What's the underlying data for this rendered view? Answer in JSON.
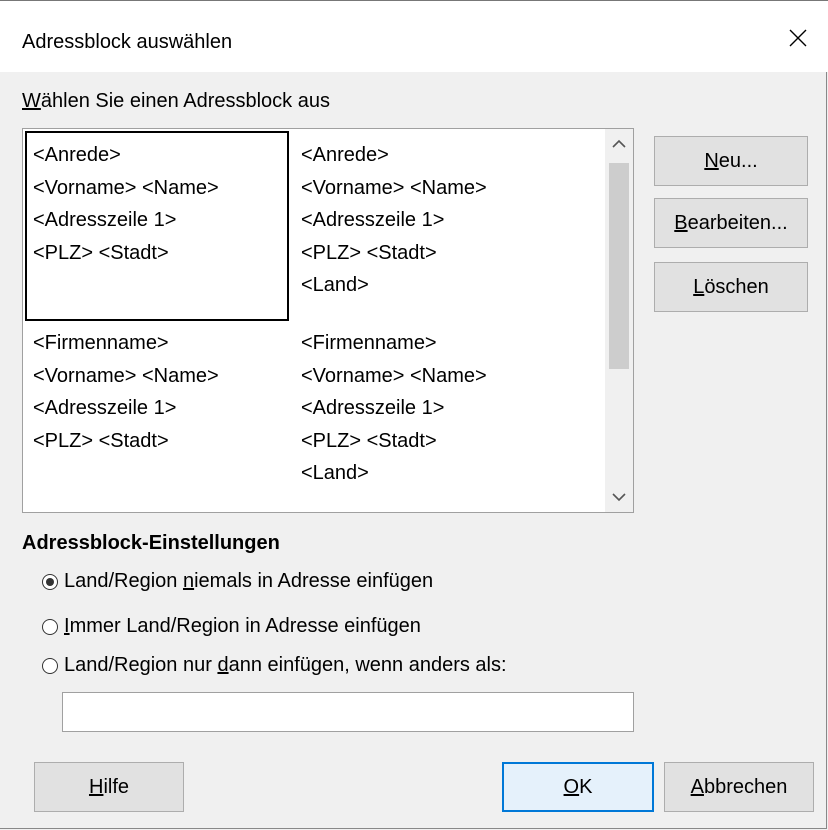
{
  "window": {
    "title": "Adressblock auswählen"
  },
  "chooser": {
    "label_underline": "W",
    "label_rest": "ählen Sie einen Adressblock aus",
    "blocks": [
      {
        "lines": [
          "<Anrede>",
          "<Vorname> <Name>",
          "<Adresszeile 1>",
          "<PLZ> <Stadt>"
        ],
        "selected": true
      },
      {
        "lines": [
          "<Anrede>",
          "<Vorname> <Name>",
          "<Adresszeile 1>",
          "<PLZ> <Stadt>",
          "<Land>"
        ],
        "selected": false
      },
      {
        "lines": [
          "<Firmenname>",
          "<Vorname> <Name>",
          "<Adresszeile 1>",
          "<PLZ> <Stadt>"
        ],
        "selected": false
      },
      {
        "lines": [
          "<Firmenname>",
          "<Vorname> <Name>",
          "<Adresszeile 1>",
          "<PLZ> <Stadt>",
          "<Land>"
        ],
        "selected": false
      }
    ]
  },
  "buttons": {
    "new": {
      "u": "N",
      "rest": "eu..."
    },
    "edit": {
      "u": "B",
      "rest": "earbeiten..."
    },
    "delete": {
      "u": "L",
      "rest": "öschen"
    },
    "help": {
      "u": "H",
      "rest": "ilfe"
    },
    "ok": {
      "u": "O",
      "rest": "K"
    },
    "cancel": {
      "u": "A",
      "rest": "bbrechen"
    }
  },
  "settings": {
    "heading": "Adressblock-Einstellungen",
    "options": [
      {
        "pre": "Land/Region ",
        "u": "n",
        "post": "iemals in Adresse einfügen",
        "checked": true
      },
      {
        "pre": "",
        "u": "I",
        "post": "mmer Land/Region in Adresse einfügen",
        "checked": false
      },
      {
        "pre": "Land/Region nur ",
        "u": "d",
        "post": "ann einfügen, wenn anders als:",
        "checked": false
      }
    ],
    "country_value": ""
  },
  "icons": {
    "close": "close-icon",
    "scroll_up": "chevron-up-icon",
    "scroll_down": "chevron-down-icon"
  }
}
